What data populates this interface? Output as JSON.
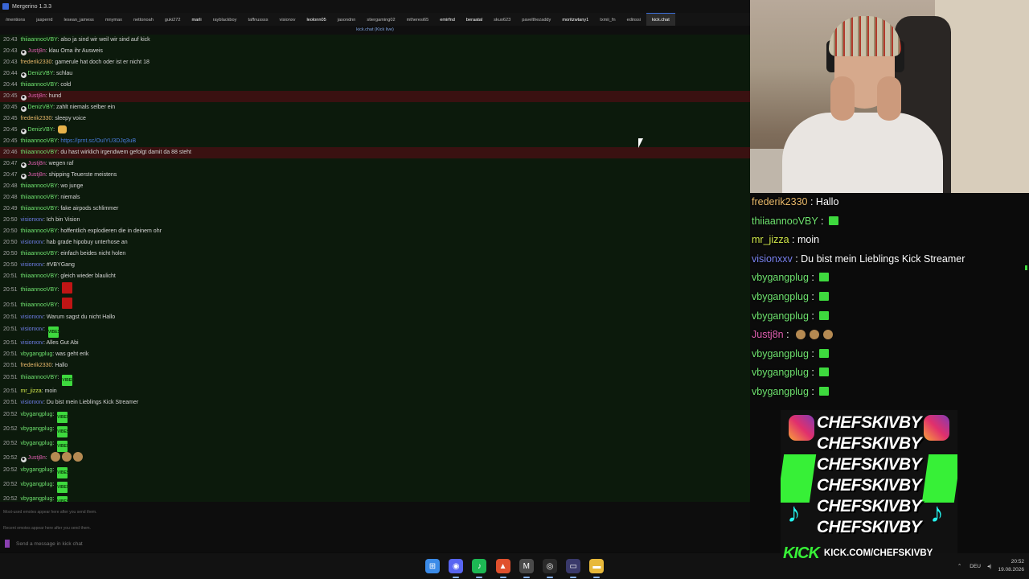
{
  "window": {
    "title": "Mergerino 1.3.3"
  },
  "tabs": [
    {
      "label": "/mentions",
      "state": "normal"
    },
    {
      "label": "jasperrd",
      "state": "normal"
    },
    {
      "label": "lesean_jamess",
      "state": "normal"
    },
    {
      "label": "mnymax",
      "state": "normal"
    },
    {
      "label": "nettonoah",
      "state": "normal"
    },
    {
      "label": "guki272",
      "state": "normal"
    },
    {
      "label": "marli",
      "state": "hl"
    },
    {
      "label": "rayblackboy",
      "state": "normal"
    },
    {
      "label": "taffnussss",
      "state": "normal"
    },
    {
      "label": "visionxv",
      "state": "normal"
    },
    {
      "label": "leolonn05",
      "state": "hl"
    },
    {
      "label": "jasondnn",
      "state": "normal"
    },
    {
      "label": "stiergaming02",
      "state": "normal"
    },
    {
      "label": "mtheresi65",
      "state": "normal"
    },
    {
      "label": "emirfnd",
      "state": "hl"
    },
    {
      "label": "beraatal",
      "state": "hl"
    },
    {
      "label": "skuo623",
      "state": "normal"
    },
    {
      "label": "pavelthezaddy",
      "state": "normal"
    },
    {
      "label": "moritzwtany1",
      "state": "hl"
    },
    {
      "label": "txmii_fn",
      "state": "normal"
    },
    {
      "label": "edinssi",
      "state": "normal"
    },
    {
      "label": "kick.chat",
      "state": "active"
    }
  ],
  "channel_header": "kick.chat (Kick live)",
  "user_colors": {
    "thiiaannooVBY": "#6fe26f",
    "Justj8n": "#e05fb0",
    "frederik2330": "#e8b86a",
    "DenizVBY": "#6fe26f",
    "visionxxv": "#6f7ee8",
    "vbygangplug": "#6fe26f",
    "mr_jizza": "#d2e84a"
  },
  "messages": [
    {
      "time": "20:43",
      "user": "thiiaannooVBY",
      "text": "also ja sind wir weil wir sind auf kick",
      "badge": false,
      "style": ""
    },
    {
      "time": "20:43",
      "user": "Justj8n",
      "text": "klau Oma ihr Ausweis",
      "badge": true,
      "style": ""
    },
    {
      "time": "20:43",
      "user": "frederik2330",
      "text": "gamerule hat doch oder ist er nicht 18",
      "badge": false,
      "style": ""
    },
    {
      "time": "20:44",
      "user": "DenizVBY",
      "text": "schlau",
      "badge": true,
      "style": ""
    },
    {
      "time": "20:44",
      "user": "thiiaannooVBY",
      "text": "cold",
      "badge": false,
      "style": ""
    },
    {
      "time": "20:45",
      "user": "Justj8n",
      "text": "hund",
      "badge": true,
      "style": "hl"
    },
    {
      "time": "20:45",
      "user": "DenizVBY",
      "text": "zahlt niemals selber ein",
      "badge": true,
      "style": ""
    },
    {
      "time": "20:45",
      "user": "frederik2330",
      "text": "sleepy voice",
      "badge": false,
      "style": ""
    },
    {
      "time": "20:45",
      "user": "DenizVBY",
      "text": "",
      "badge": true,
      "style": "",
      "emote": "face"
    },
    {
      "time": "20:45",
      "user": "thiiaannooVBY",
      "text": "https://prnt.sc/OuIYU3DJq3uB",
      "badge": false,
      "style": "",
      "link": true
    },
    {
      "time": "20:46",
      "user": "thiiaannooVBY",
      "text": "du hast wirklich irgendwem gefolgt damit da 88 steht",
      "badge": false,
      "style": "hl"
    },
    {
      "time": "20:47",
      "user": "Justj8n",
      "text": "wegen raf",
      "badge": true,
      "style": ""
    },
    {
      "time": "20:47",
      "user": "Justj8n",
      "text": "shipping Teuerste meistens",
      "badge": true,
      "style": ""
    },
    {
      "time": "20:48",
      "user": "thiiaannooVBY",
      "text": "wo junge",
      "badge": false,
      "style": ""
    },
    {
      "time": "20:48",
      "user": "thiiaannooVBY",
      "text": "niemals",
      "badge": false,
      "style": ""
    },
    {
      "time": "20:49",
      "user": "thiiaannooVBY",
      "text": "fake airpods schlimmer",
      "badge": false,
      "style": ""
    },
    {
      "time": "20:50",
      "user": "visionxxv",
      "text": "Ich bin Vision",
      "badge": false,
      "style": ""
    },
    {
      "time": "20:50",
      "user": "thiiaannooVBY",
      "text": "hoffentlich explodieren die in deinem ohr",
      "badge": false,
      "style": ""
    },
    {
      "time": "20:50",
      "user": "visionxxv",
      "text": "hab grade hipobuy unterhose an",
      "badge": false,
      "style": ""
    },
    {
      "time": "20:50",
      "user": "thiiaannooVBY",
      "text": "einfach beides nicht holen",
      "badge": false,
      "style": ""
    },
    {
      "time": "20:50",
      "user": "visionxxv",
      "text": "#VBYGang",
      "badge": false,
      "style": ""
    },
    {
      "time": "20:51",
      "user": "thiiaannooVBY",
      "text": "gleich wieder blaulicht",
      "badge": false,
      "style": ""
    },
    {
      "time": "20:51",
      "user": "thiiaannooVBY",
      "text": "",
      "badge": false,
      "style": "",
      "emote": "red"
    },
    {
      "time": "20:51",
      "user": "thiiaannooVBY",
      "text": "",
      "badge": false,
      "style": "",
      "emote": "red"
    },
    {
      "time": "20:51",
      "user": "visionxxv",
      "text": "Warum sagst du nicht Hallo",
      "badge": false,
      "style": ""
    },
    {
      "time": "20:51",
      "user": "visionxxv",
      "text": "",
      "badge": false,
      "style": "",
      "emote": "vibes"
    },
    {
      "time": "20:51",
      "user": "visionxxv",
      "text": "Alles Gut Abi",
      "badge": false,
      "style": ""
    },
    {
      "time": "20:51",
      "user": "vbygangplug",
      "text": "was geht erik",
      "badge": false,
      "style": ""
    },
    {
      "time": "20:51",
      "user": "frederik2330",
      "text": "Hallo",
      "badge": false,
      "style": ""
    },
    {
      "time": "20:51",
      "user": "thiiaannooVBY",
      "text": "",
      "badge": false,
      "style": "",
      "emote": "vibes"
    },
    {
      "time": "20:51",
      "user": "mr_jizza",
      "text": "moin",
      "badge": false,
      "style": ""
    },
    {
      "time": "20:51",
      "user": "visionxxv",
      "text": "Du bist mein Lieblings Kick Streamer",
      "badge": false,
      "style": ""
    },
    {
      "time": "20:52",
      "user": "vbygangplug",
      "text": "",
      "badge": false,
      "style": "",
      "emote": "vibes"
    },
    {
      "time": "20:52",
      "user": "vbygangplug",
      "text": "",
      "badge": false,
      "style": "",
      "emote": "vibes"
    },
    {
      "time": "20:52",
      "user": "vbygangplug",
      "text": "",
      "badge": false,
      "style": "",
      "emote": "vibes"
    },
    {
      "time": "20:52",
      "user": "Justj8n",
      "text": "",
      "badge": true,
      "style": "",
      "emote": "dog3"
    },
    {
      "time": "20:52",
      "user": "vbygangplug",
      "text": "",
      "badge": false,
      "style": "",
      "emote": "vibes"
    },
    {
      "time": "20:52",
      "user": "vbygangplug",
      "text": "",
      "badge": false,
      "style": "",
      "emote": "vibes"
    },
    {
      "time": "20:52",
      "user": "vbygangplug",
      "text": "",
      "badge": false,
      "style": "",
      "emote": "vibes"
    }
  ],
  "emote_text": {
    "vibes": "VIBES"
  },
  "footer": {
    "hint_most_used": "Most-used emotes appear here after you send them.",
    "hint_recent": "Recent emotes appear here after you send them.",
    "input_placeholder": "Send a message in kick chat"
  },
  "overlay_chat": [
    {
      "user": "frederik2330",
      "text": "Hallo",
      "emote": "",
      "color": "#e8b86a"
    },
    {
      "user": "thiiaannooVBY",
      "text": "",
      "emote": "vibes",
      "color": "#6fe26f"
    },
    {
      "user": "mr_jizza",
      "text": "moin",
      "emote": "",
      "color": "#d2e84a"
    },
    {
      "user": "visionxxv",
      "text": "Du bist mein Lieblings Kick Streamer",
      "emote": "",
      "color": "#7a82ef"
    },
    {
      "user": "vbygangplug",
      "text": "",
      "emote": "vibes",
      "color": "#6fe26f"
    },
    {
      "user": "vbygangplug",
      "text": "",
      "emote": "vibes",
      "color": "#6fe26f"
    },
    {
      "user": "vbygangplug",
      "text": "",
      "emote": "vibes",
      "color": "#6fe26f"
    },
    {
      "user": "Justj8n",
      "text": "",
      "emote": "dog3",
      "color": "#e05fb0"
    },
    {
      "user": "vbygangplug",
      "text": "",
      "emote": "vibes",
      "color": "#6fe26f"
    },
    {
      "user": "vbygangplug",
      "text": "",
      "emote": "vibes",
      "color": "#6fe26f"
    },
    {
      "user": "vbygangplug",
      "text": "",
      "emote": "vibes",
      "color": "#6fe26f"
    }
  ],
  "overlay_separator": ":",
  "promo": {
    "lines": [
      "CHEFSKIVBY",
      "CHEFSKIVBY",
      "CHEFSKIVBY",
      "CHEFSKIVBY",
      "CHEFSKIVBY",
      "CHEFSKIVBY"
    ],
    "kick_word": "KICK",
    "url": "KICK.COM/CHEFSKIVBY"
  },
  "taskbar": {
    "apps": [
      {
        "name": "windows-start-icon",
        "glyph": "⊞",
        "color": "#3b8be8"
      },
      {
        "name": "discord-icon",
        "glyph": "◉",
        "color": "#5865f2"
      },
      {
        "name": "spotify-icon",
        "glyph": "♪",
        "color": "#1db954"
      },
      {
        "name": "brave-icon",
        "glyph": "▲",
        "color": "#e0502d"
      },
      {
        "name": "mergerino-icon",
        "glyph": "M",
        "color": "#4a4a4a"
      },
      {
        "name": "obs-icon",
        "glyph": "◎",
        "color": "#2a2a2a"
      },
      {
        "name": "chat-app-icon",
        "glyph": "▭",
        "color": "#39396b"
      },
      {
        "name": "file-explorer-icon",
        "glyph": "▬",
        "color": "#e8b93a"
      }
    ],
    "language": "DEU",
    "time": "20:52",
    "date": "19.08.2026"
  }
}
